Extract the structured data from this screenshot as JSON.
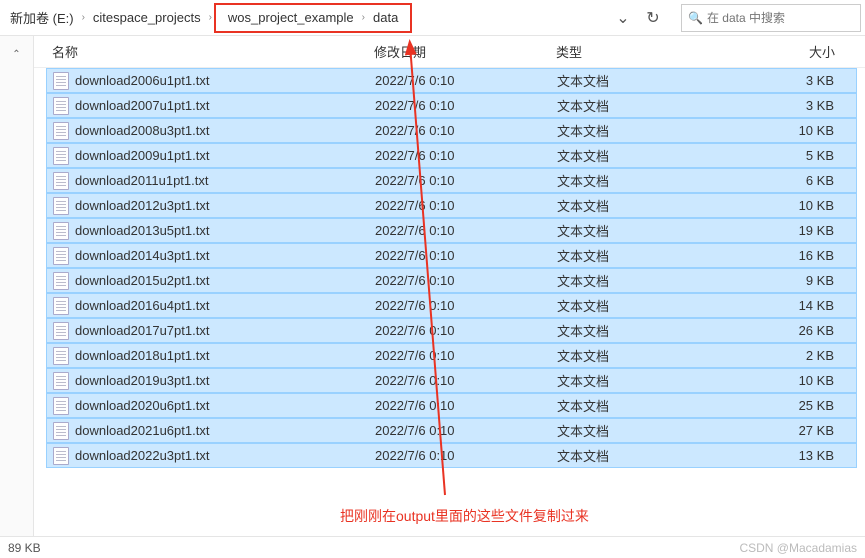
{
  "breadcrumb": {
    "drive": "新加卷 (E:)",
    "p1": "citespace_projects",
    "p2": "wos_project_example",
    "p3": "data"
  },
  "search": {
    "placeholder": "在 data 中搜索"
  },
  "headers": {
    "name": "名称",
    "date": "修改日期",
    "type": "类型",
    "size": "大小"
  },
  "files": [
    {
      "name": "download2006u1pt1.txt",
      "date": "2022/7/6 0:10",
      "type": "文本文档",
      "size": "3 KB"
    },
    {
      "name": "download2007u1pt1.txt",
      "date": "2022/7/6 0:10",
      "type": "文本文档",
      "size": "3 KB"
    },
    {
      "name": "download2008u3pt1.txt",
      "date": "2022/7/6 0:10",
      "type": "文本文档",
      "size": "10 KB"
    },
    {
      "name": "download2009u1pt1.txt",
      "date": "2022/7/6 0:10",
      "type": "文本文档",
      "size": "5 KB"
    },
    {
      "name": "download2011u1pt1.txt",
      "date": "2022/7/6 0:10",
      "type": "文本文档",
      "size": "6 KB"
    },
    {
      "name": "download2012u3pt1.txt",
      "date": "2022/7/6 0:10",
      "type": "文本文档",
      "size": "10 KB"
    },
    {
      "name": "download2013u5pt1.txt",
      "date": "2022/7/6 0:10",
      "type": "文本文档",
      "size": "19 KB"
    },
    {
      "name": "download2014u3pt1.txt",
      "date": "2022/7/6 0:10",
      "type": "文本文档",
      "size": "16 KB"
    },
    {
      "name": "download2015u2pt1.txt",
      "date": "2022/7/6 0:10",
      "type": "文本文档",
      "size": "9 KB"
    },
    {
      "name": "download2016u4pt1.txt",
      "date": "2022/7/6 0:10",
      "type": "文本文档",
      "size": "14 KB"
    },
    {
      "name": "download2017u7pt1.txt",
      "date": "2022/7/6 0:10",
      "type": "文本文档",
      "size": "26 KB"
    },
    {
      "name": "download2018u1pt1.txt",
      "date": "2022/7/6 0:10",
      "type": "文本文档",
      "size": "2 KB"
    },
    {
      "name": "download2019u3pt1.txt",
      "date": "2022/7/6 0:10",
      "type": "文本文档",
      "size": "10 KB"
    },
    {
      "name": "download2020u6pt1.txt",
      "date": "2022/7/6 0:10",
      "type": "文本文档",
      "size": "25 KB"
    },
    {
      "name": "download2021u6pt1.txt",
      "date": "2022/7/6 0:10",
      "type": "文本文档",
      "size": "27 KB"
    },
    {
      "name": "download2022u3pt1.txt",
      "date": "2022/7/6 0:10",
      "type": "文本文档",
      "size": "13 KB"
    }
  ],
  "caption": "把刚刚在output里面的这些文件复制过来",
  "status": {
    "size": "89 KB"
  },
  "watermark": "CSDN @Macadamias"
}
